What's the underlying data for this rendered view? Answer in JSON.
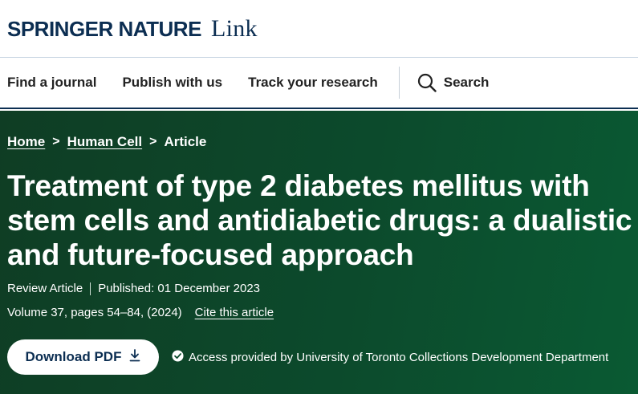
{
  "header": {
    "brand_primary": "SPRINGER NATURE",
    "brand_secondary": "Link"
  },
  "nav": {
    "items": [
      {
        "label": "Find a journal"
      },
      {
        "label": "Publish with us"
      },
      {
        "label": "Track your research"
      }
    ],
    "search_label": "Search",
    "search_icon": "search-icon"
  },
  "breadcrumb": {
    "home": "Home",
    "journal": "Human Cell",
    "current": "Article",
    "separator": ">"
  },
  "article": {
    "title": "Treatment of type 2 diabetes mellitus with stem cells and antidiabetic drugs: a dualistic and future-focused approach",
    "type": "Review Article",
    "published": "Published: 01 December 2023",
    "volume": "Volume 37, pages 54–84, (2024)",
    "cite_label": "Cite this article"
  },
  "actions": {
    "download_label": "Download PDF",
    "download_icon": "download-icon",
    "access_icon": "check-circle-icon",
    "access_text": "Access provided by University of Toronto Collections Development Department"
  },
  "colors": {
    "brand_navy": "#0c2e52",
    "hero_green": "#0c4a2c",
    "white": "#ffffff"
  }
}
